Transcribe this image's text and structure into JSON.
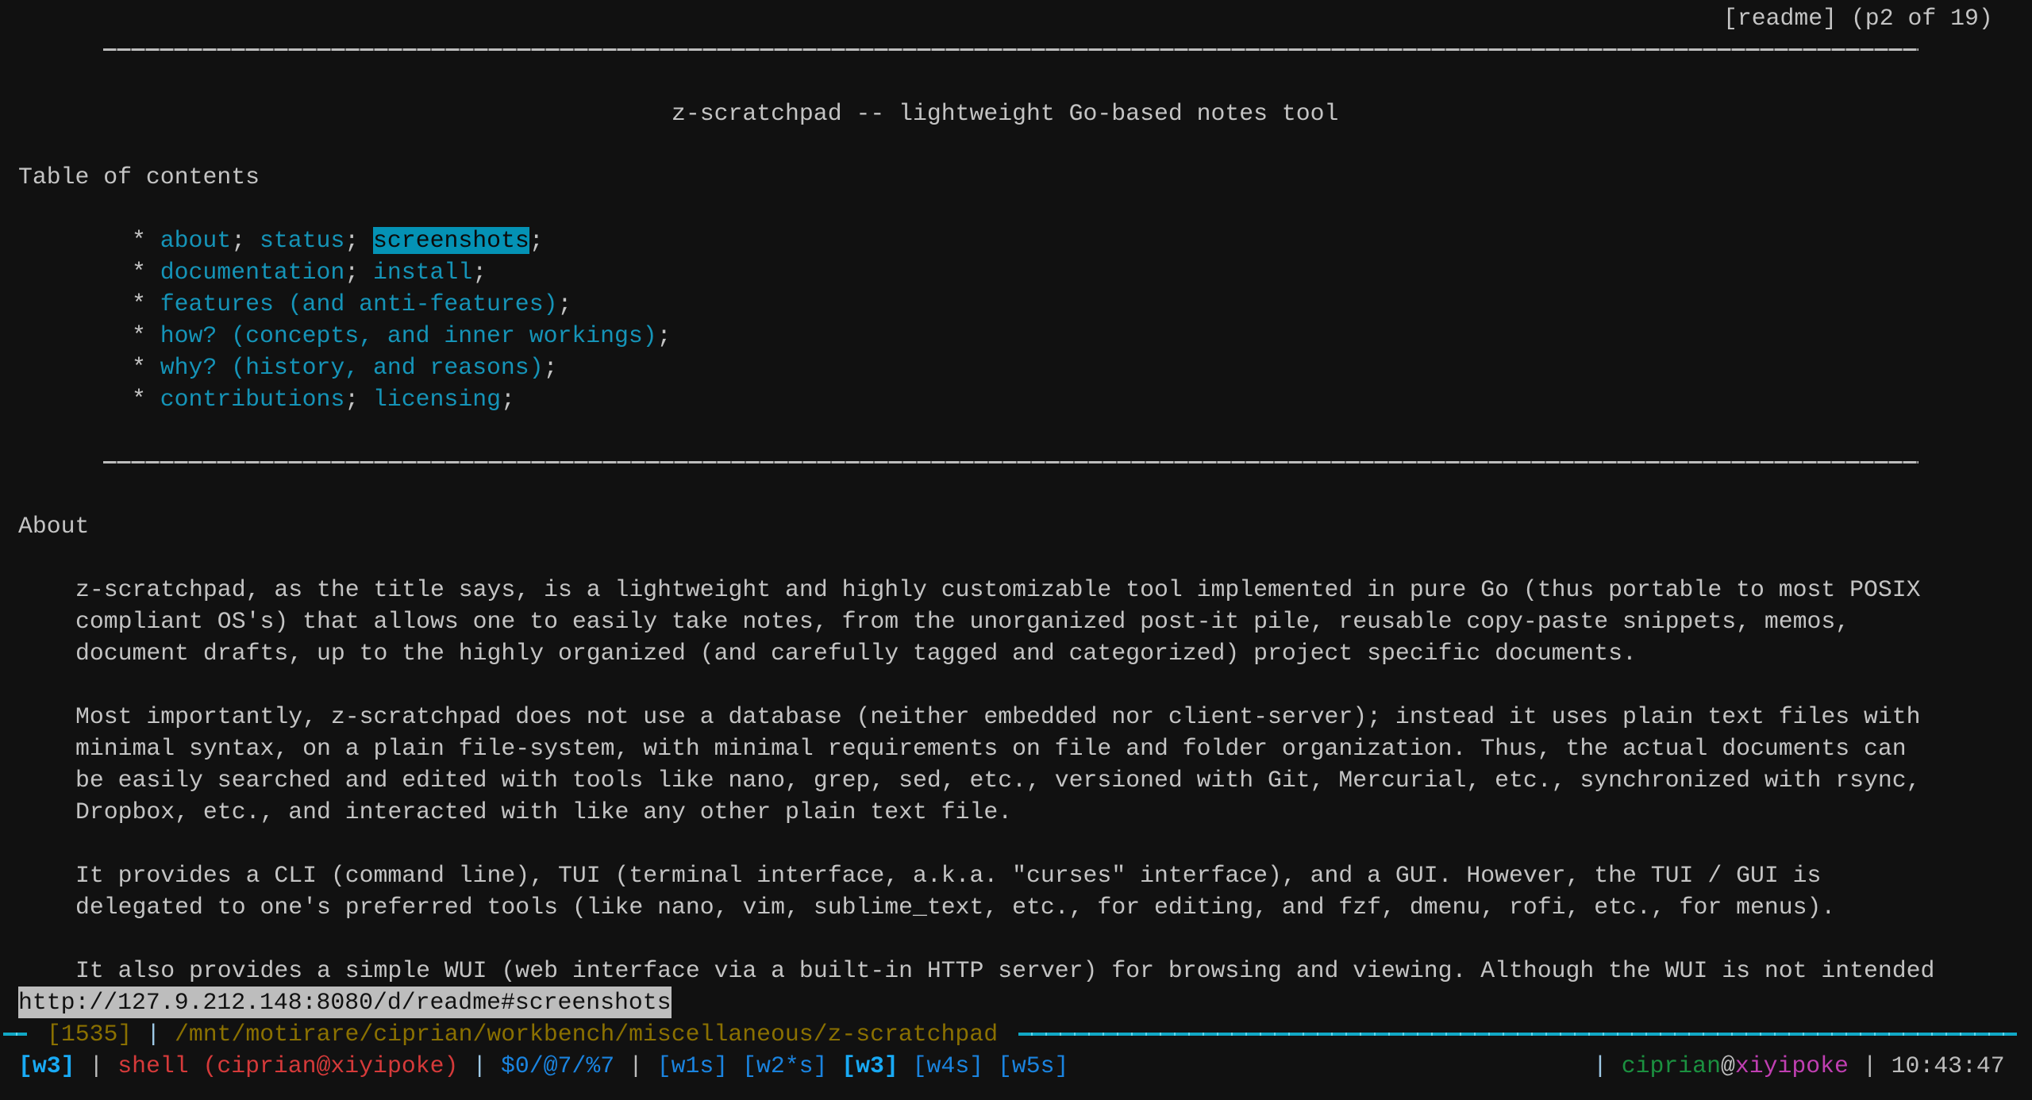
{
  "pager": {
    "indicator": "[readme] (p2 of 19)"
  },
  "document": {
    "title": "z-scratchpad -- lightweight Go-based notes tool",
    "toc_heading": "Table of contents",
    "toc": [
      [
        {
          "label": "about"
        },
        {
          "label": "status"
        },
        {
          "label": "screenshots",
          "selected": true
        }
      ],
      [
        {
          "label": "documentation"
        },
        {
          "label": "install"
        }
      ],
      [
        {
          "label": "features (and anti-features)"
        }
      ],
      [
        {
          "label": "how? (concepts, and inner workings)"
        }
      ],
      [
        {
          "label": "why? (history, and reasons)"
        }
      ],
      [
        {
          "label": "contributions"
        },
        {
          "label": "licensing"
        }
      ]
    ],
    "bullet": "*",
    "separator": ";",
    "about_heading": "About",
    "paragraphs": [
      [
        "z-scratchpad, as the title says, is a lightweight and highly customizable tool implemented in pure Go (thus portable to most POSIX",
        "compliant OS's) that allows one to easily take notes, from the unorganized post-it pile, reusable copy-paste snippets, memos,",
        "document drafts, up to the highly organized (and carefully tagged and categorized) project specific documents."
      ],
      [
        "Most importantly, z-scratchpad does not use a database (neither embedded nor client-server); instead it uses plain text files with",
        "minimal syntax, on a plain file-system, with minimal requirements on file and folder organization. Thus, the actual documents can",
        "be easily searched and edited with tools like nano, grep, sed, etc., versioned with Git, Mercurial, etc., synchronized with rsync,",
        "Dropbox, etc., and interacted with like any other plain text file."
      ],
      [
        "It provides a CLI (command line), TUI (terminal interface, a.k.a. \"curses\" interface), and a GUI. However, the TUI / GUI is",
        "delegated to one's preferred tools (like nano, vim, sublime_text, etc., for editing, and fzf, dmenu, rofi, etc., for menus)."
      ],
      [
        "It also provides a simple WUI (web interface via a built-in HTTP server) for browsing and viewing. Although the WUI is not intended"
      ]
    ]
  },
  "link_status": {
    "url": "http://127.9.212.148:8080/d/readme#screenshots"
  },
  "pane_border": {
    "lead": "─",
    "lines": "[1535]",
    "sep": "|",
    "path": "/mnt/motirare/ciprian/workbench/miscellaneous/z-scratchpad"
  },
  "tmux": {
    "session": "[w3]",
    "sep": "|",
    "pane_title": "shell (ciprian@xiyipoke)",
    "ids": "$0/@7/%7",
    "windows": [
      {
        "label": "[w1s]",
        "current": false
      },
      {
        "label": "[w2*s]",
        "current": false
      },
      {
        "label": "[w3]",
        "current": true
      },
      {
        "label": "[w4s]",
        "current": false
      },
      {
        "label": "[w5s]",
        "current": false
      }
    ],
    "user": "ciprian",
    "at": "@",
    "host": "xiyipoke",
    "clock": "10:43:47"
  },
  "colors": {
    "background": "#111111",
    "text": "#c4c4c4",
    "link": "#1594b8",
    "selection": "#0492b5",
    "status_path": "#8a7000",
    "pane_border": "#11a8c6"
  }
}
